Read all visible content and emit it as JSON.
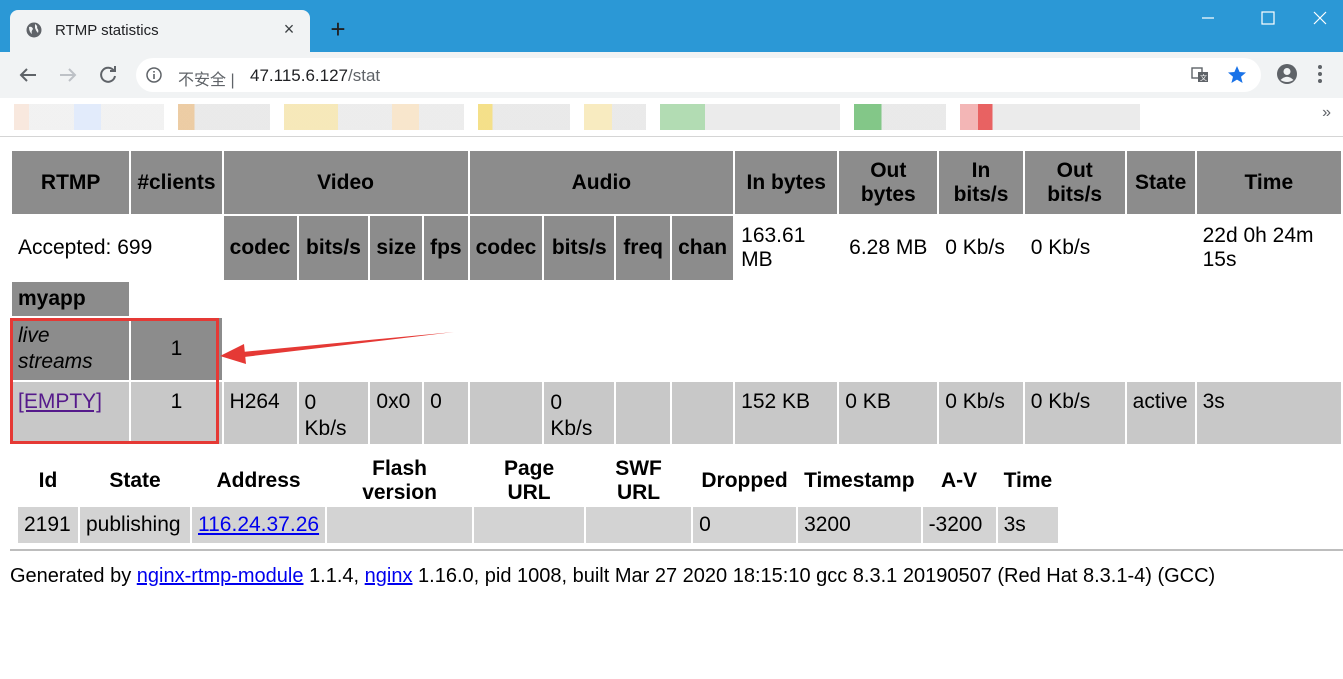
{
  "browser": {
    "tab_title": "RTMP statistics",
    "tab_close": "×",
    "new_tab": "+",
    "insecure_label": "不安全 |",
    "url_host": "47.115.6.127",
    "url_path": "/stat",
    "more_bookmarks": "»"
  },
  "main_table": {
    "headers": {
      "rtmp": "RTMP",
      "clients": "#clients",
      "video": "Video",
      "audio": "Audio",
      "in_bytes": "In bytes",
      "out_bytes": "Out bytes",
      "in_bits": "In bits/s",
      "out_bits": "Out bits/s",
      "state": "State",
      "time": "Time"
    },
    "sub_headers": {
      "v_codec": "codec",
      "v_bits": "bits/s",
      "v_size": "size",
      "v_fps": "fps",
      "a_codec": "codec",
      "a_bits": "bits/s",
      "a_freq": "freq",
      "a_chan": "chan"
    },
    "accepted_row": {
      "label": "Accepted: 699",
      "in_bytes": "163.61 MB",
      "out_bytes": "6.28 MB",
      "in_bits": "0 Kb/s",
      "out_bits": "0 Kb/s",
      "time": "22d 0h 24m 15s"
    },
    "app_name": "myapp",
    "live_streams": {
      "label": "live streams",
      "count": "1"
    },
    "stream_row": {
      "name": "[EMPTY]",
      "clients": "1",
      "v_codec": "H264",
      "v_bits": "0 Kb/s",
      "v_size": "0x0",
      "v_fps": "0",
      "a_codec": "",
      "a_bits": "0 Kb/s",
      "a_freq": "",
      "a_chan": "",
      "in_bytes": "152 KB",
      "out_bytes": "0 KB",
      "in_bits": "0 Kb/s",
      "out_bits": "0 Kb/s",
      "state": "active",
      "time": "3s"
    }
  },
  "clients_table": {
    "headers": [
      "Id",
      "State",
      "Address",
      "Flash version",
      "Page URL",
      "SWF URL",
      "Dropped",
      "Timestamp",
      "A-V",
      "Time"
    ],
    "row": {
      "id": "2191",
      "state": "publishing",
      "address": "116.24.37.26",
      "flash_version": "",
      "page_url": "",
      "swf_url": "",
      "dropped": "0",
      "timestamp": "3200",
      "av": "-3200",
      "time": "3s"
    }
  },
  "footer": {
    "prefix": "Generated by",
    "module_link": "nginx-rtmp-module",
    "module_version": "1.1.4,",
    "nginx_link": "nginx",
    "details": "1.16.0, pid 1008, built Mar 27 2020 18:15:10 gcc 8.3.1 20190507 (Red Hat 8.3.1-4) (GCC)"
  },
  "colors": {
    "titlebar": "#2b98d6",
    "header_bg": "#8c8c8c",
    "row_bg": "#d3d3d3",
    "annotation": "#e53935"
  }
}
